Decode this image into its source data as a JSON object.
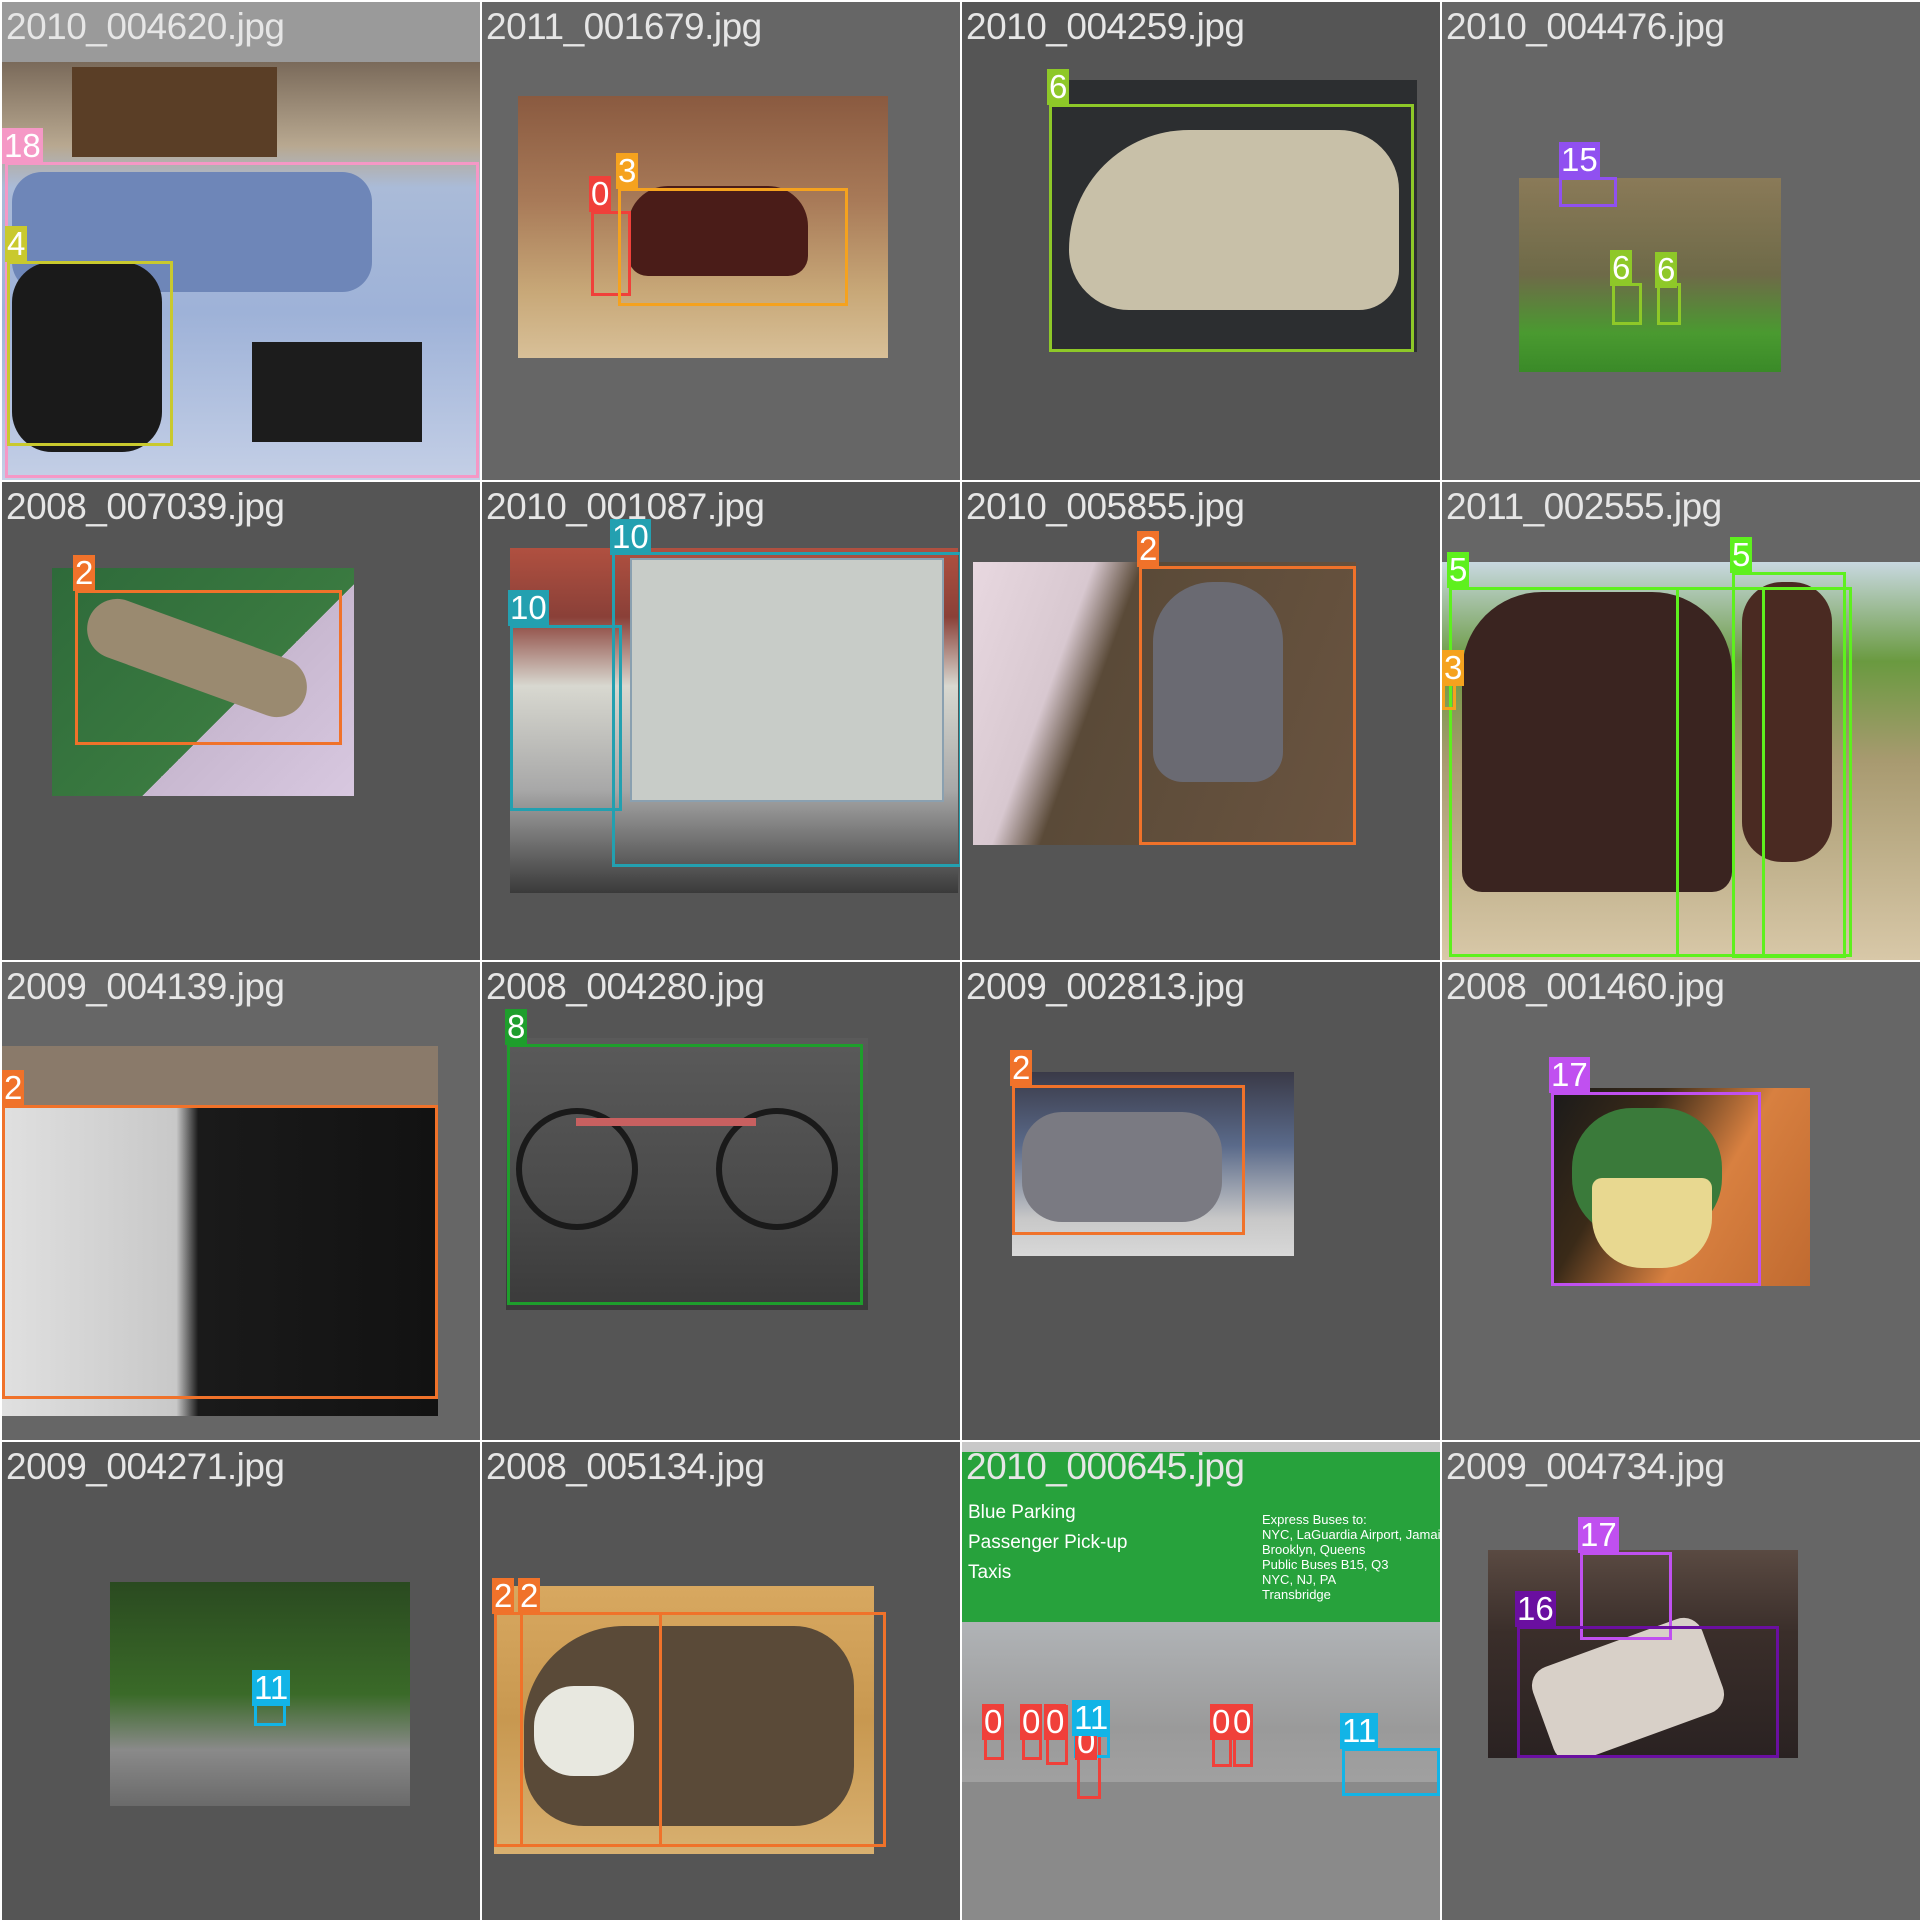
{
  "grid": {
    "tiles": [
      {
        "filename": "2010_004620.jpg",
        "labels": [
          "18",
          "4"
        ]
      },
      {
        "filename": "2011_001679.jpg",
        "labels": [
          "0",
          "3"
        ]
      },
      {
        "filename": "2010_004259.jpg",
        "labels": [
          "6"
        ]
      },
      {
        "filename": "2010_004476.jpg",
        "labels": [
          "15",
          "6",
          "6"
        ]
      },
      {
        "filename": "2008_007039.jpg",
        "labels": [
          "2"
        ]
      },
      {
        "filename": "2010_001087.jpg",
        "labels": [
          "10",
          "10"
        ]
      },
      {
        "filename": "2010_005855.jpg",
        "labels": [
          "2"
        ]
      },
      {
        "filename": "2011_002555.jpg",
        "labels": [
          "5",
          "5",
          "3"
        ]
      },
      {
        "filename": "2009_004139.jpg",
        "labels": [
          "2"
        ]
      },
      {
        "filename": "2008_004280.jpg",
        "labels": [
          "8"
        ]
      },
      {
        "filename": "2009_002813.jpg",
        "labels": [
          "2"
        ]
      },
      {
        "filename": "2008_001460.jpg",
        "labels": [
          "17"
        ]
      },
      {
        "filename": "2009_004271.jpg",
        "labels": [
          "11"
        ]
      },
      {
        "filename": "2008_005134.jpg",
        "labels": [
          "2",
          "2"
        ]
      },
      {
        "filename": "2010_000645.jpg",
        "labels": [
          "0",
          "0",
          "0",
          "0",
          "11",
          "0",
          "0",
          "11"
        ]
      },
      {
        "filename": "2009_004734.jpg",
        "labels": [
          "17",
          "16"
        ]
      }
    ]
  },
  "signage": {
    "left": [
      "Blue Parking",
      "Passenger Pick-up",
      "Taxis"
    ],
    "right": [
      "Express Buses to:",
      "NYC, LaGuardia Airport, Jamaica Station",
      "Brooklyn, Queens",
      "Public Buses B15, Q3",
      "NYC, NJ, PA",
      "Transbridge"
    ]
  },
  "colors": {
    "0": "#f0403a",
    "2": "#f0722a",
    "3": "#f5a21e",
    "4": "#c9c92e",
    "5": "#5ef01e",
    "6": "#8ec828",
    "8": "#1e9e2c",
    "10": "#23a0b0",
    "11": "#12b4e6",
    "15": "#9050f0",
    "16": "#6a0fa0",
    "17": "#c050f0",
    "18": "#f598c6"
  }
}
